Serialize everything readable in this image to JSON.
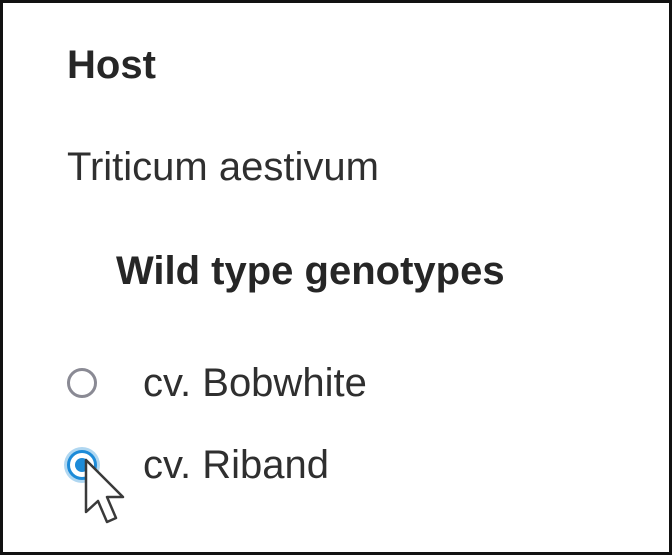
{
  "host": {
    "heading": "Host",
    "value": "Triticum aestivum"
  },
  "genotypes": {
    "heading": "Wild type genotypes",
    "options": [
      {
        "label": "cv. Bobwhite",
        "selected": false
      },
      {
        "label": "cv. Riband",
        "selected": true
      }
    ]
  },
  "colors": {
    "accent": "#1d8bd8",
    "radio_border": "#8a8a94",
    "text": "#2f2f2f",
    "frame": "#111111"
  },
  "cursor_icon": "arrow-pointer-icon"
}
